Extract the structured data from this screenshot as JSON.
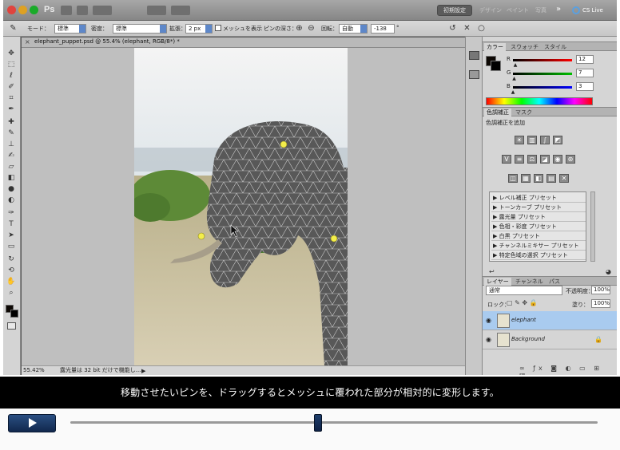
{
  "app": {
    "logo": "Ps",
    "workspace_button": "初期設定",
    "workspace_tabs": [
      "デザイン",
      "ペイント",
      "写真"
    ],
    "more": "»",
    "cs_live": "CS Live"
  },
  "options": {
    "mode_label": "モード：",
    "mode_value": "標準",
    "density_label": "密度：",
    "density_value": "標準",
    "expand_label": "拡張：",
    "expand_value": "2 px",
    "show_mesh_label": "メッシュを表示",
    "pin_depth_label": "ピンの深さ：",
    "rotate_label": "回転：",
    "rotate_value": "自動",
    "angle_value": "-138",
    "angle_unit": "°",
    "commit_icon": "✓",
    "cancel_icon": "✕",
    "reset_icon": "↺"
  },
  "document": {
    "tab_title": "elephant_puppet.psd @ 55.4% (elephant, RGB/8*) *",
    "close": "×",
    "zoom": "55.42%",
    "status": "露光量は 32 bit だけで機能し..."
  },
  "color_panel": {
    "tabs": [
      "カラー",
      "スウォッチ",
      "スタイル"
    ],
    "r_label": "R",
    "g_label": "G",
    "b_label": "B",
    "r_value": "12",
    "g_value": "7",
    "b_value": "3",
    "r_level": 0.05,
    "g_level": 0.03,
    "b_level": 0.01
  },
  "adjustments_panel": {
    "tabs": [
      "色調補正",
      "マスク"
    ],
    "title": "色調補正を追加",
    "presets": [
      "レベル補正 プリセット",
      "トーンカーブ プリセット",
      "露光量 プリセット",
      "色相・彩度 プリセット",
      "白黒 プリセット",
      "チャンネルミキサー プリセット",
      "特定色域の選択 プリセット"
    ]
  },
  "layers_panel": {
    "tabs": [
      "レイヤー",
      "チャンネル",
      "パス"
    ],
    "blend_mode": "通常",
    "opacity_label": "不透明度：",
    "opacity_value": "100%",
    "lock_label": "ロック：",
    "fill_label": "塗り：",
    "fill_value": "100%",
    "layers": [
      {
        "name": "elephant",
        "selected": true
      },
      {
        "name": "Background",
        "selected": false
      }
    ]
  },
  "subtitle": "移動させたいピンを、ドラッグするとメッシュに覆われた部分が相対的に変形します。",
  "player": {
    "progress": 0.47
  },
  "colors": {
    "traffic_red": "#e0443e",
    "traffic_yellow": "#dea123",
    "traffic_green": "#1aab29",
    "pin": "#f4ee4a",
    "selected_layer": "#a9cbef",
    "player_blue": "#1b3966"
  }
}
